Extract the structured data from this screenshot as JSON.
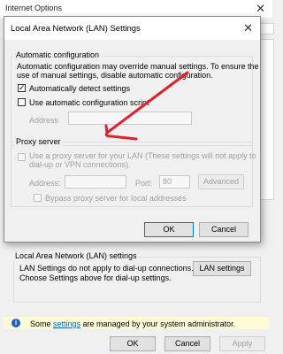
{
  "parent": {
    "title": "Internet Options",
    "lan_group": "Local Area Network (LAN) settings",
    "lan_text_1": "LAN Settings do not apply to dial-up connections.",
    "lan_text_2": "Choose Settings above for dial-up settings.",
    "lan_button": "LAN settings",
    "info_prefix": "Some ",
    "info_link": "settings",
    "info_suffix": " are managed by your system administrator.",
    "ok": "OK",
    "cancel": "Cancel",
    "apply": "Apply"
  },
  "dialog": {
    "title": "Local Area Network (LAN) Settings",
    "auto_group": "Automatic configuration",
    "auto_desc_1": "Automatic configuration may override manual settings.  To ensure the",
    "auto_desc_2": "use of manual settings, disable automatic configuration.",
    "auto_detect_label": "Automatically detect settings",
    "auto_detect_checked": true,
    "use_script_label": "Use automatic configuration script",
    "use_script_checked": false,
    "address_label": "Address",
    "address_value": "",
    "proxy_group": "Proxy server",
    "proxy_use_1": "Use a proxy server for your LAN (These settings will not apply to",
    "proxy_use_2": "dial-up or VPN connections).",
    "proxy_address_label": "Address:",
    "proxy_address_value": "",
    "port_label": "Port:",
    "port_value": "80",
    "advanced": "Advanced",
    "bypass_label": "Bypass proxy server for local addresses",
    "ok": "OK",
    "cancel": "Cancel"
  },
  "annotation": {
    "color": "#e0202a"
  }
}
